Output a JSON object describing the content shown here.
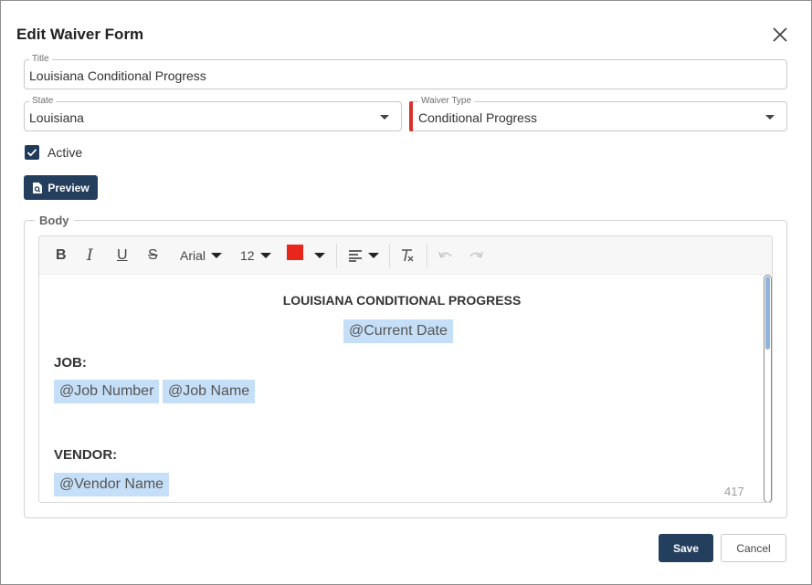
{
  "dialog": {
    "title": "Edit Waiver Form",
    "close_icon": "close-icon"
  },
  "form": {
    "title_field": {
      "label": "Title",
      "value": "Louisiana Conditional Progress"
    },
    "state_field": {
      "label": "State",
      "value": "Louisiana"
    },
    "waiver_type_field": {
      "label": "Waiver Type",
      "value": "Conditional Progress",
      "required_color": "#d9302c"
    },
    "active": {
      "label": "Active",
      "checked": true
    },
    "preview_button": {
      "label": "Preview",
      "icon": "document-search-icon"
    }
  },
  "body_editor": {
    "legend": "Body",
    "toolbar": {
      "bold": "B",
      "italic": "I",
      "underline": "U",
      "strike": "S",
      "font": "Arial",
      "font_size": "12",
      "text_color": "#e8261c",
      "align_icon": "align-left-icon",
      "clear_format_icon": "clear-format-icon",
      "undo_icon": "undo-icon",
      "redo_icon": "redo-icon"
    },
    "content": {
      "heading": "LOUISIANA CONDITIONAL PROGRESS",
      "current_date_token": "@Current Date",
      "job_label": "JOB:",
      "job_number_token": "@Job Number",
      "job_name_token": "@Job Name",
      "vendor_label": "VENDOR:",
      "vendor_name_token": "@Vendor Name"
    },
    "char_count": "417"
  },
  "footer": {
    "save_label": "Save",
    "cancel_label": "Cancel"
  },
  "colors": {
    "primary": "#243f5e",
    "token_highlight": "#c5dff8"
  }
}
